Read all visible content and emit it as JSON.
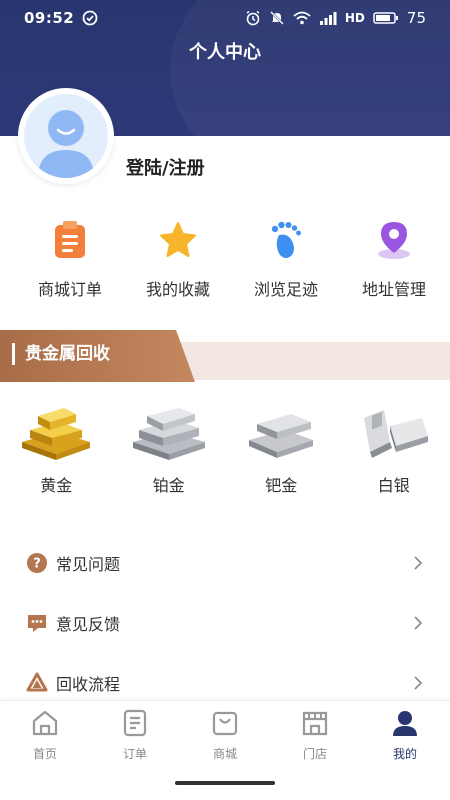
{
  "status_bar": {
    "time": "09:52",
    "battery": "75",
    "network": "HD",
    "icons": [
      "alarm-icon",
      "mute-icon",
      "wifi-icon",
      "signal-icon",
      "battery-icon"
    ]
  },
  "header": {
    "title": "个人中心"
  },
  "profile": {
    "login_label": "登陆/注册",
    "avatar_icon": "user-avatar-icon"
  },
  "quick_actions": [
    {
      "label": "商城订单",
      "icon": "clipboard-icon",
      "color": "#f2803a"
    },
    {
      "label": "我的收藏",
      "icon": "star-icon",
      "color": "#f7b52b"
    },
    {
      "label": "浏览足迹",
      "icon": "footprint-icon",
      "color": "#3e8ff0"
    },
    {
      "label": "地址管理",
      "icon": "location-pin-icon",
      "color": "#9a56e0"
    }
  ],
  "section": {
    "title": "贵金属回收",
    "accent": "#b3764f"
  },
  "metals": [
    {
      "label": "黄金",
      "icon": "gold-bar-icon"
    },
    {
      "label": "铂金",
      "icon": "platinum-bar-icon"
    },
    {
      "label": "钯金",
      "icon": "palladium-bar-icon"
    },
    {
      "label": "白银",
      "icon": "silver-bar-icon"
    }
  ],
  "menu": [
    {
      "label": "常见问题",
      "icon": "question-icon"
    },
    {
      "label": "意见反馈",
      "icon": "feedback-icon"
    },
    {
      "label": "回收流程",
      "icon": "recycle-icon"
    }
  ],
  "tabbar": [
    {
      "label": "首页",
      "icon": "home-icon",
      "active": false
    },
    {
      "label": "订单",
      "icon": "order-icon",
      "active": false
    },
    {
      "label": "商城",
      "icon": "shop-bag-icon",
      "active": false
    },
    {
      "label": "门店",
      "icon": "store-icon",
      "active": false
    },
    {
      "label": "我的",
      "icon": "profile-icon",
      "active": true
    }
  ],
  "colors": {
    "header_bg": "#29356f",
    "active_tab": "#29356f",
    "menu_icon": "#b3764f"
  }
}
